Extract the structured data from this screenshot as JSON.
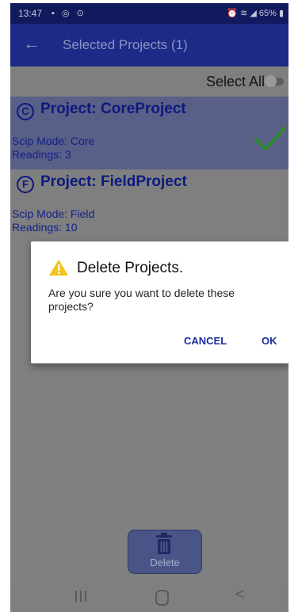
{
  "status_bar": {
    "time": "13:47",
    "left_icons": "▪ ◎ ⊙",
    "right_text": "⏰ ≋ ◢ 65% ▮"
  },
  "app_bar": {
    "back_icon": "←",
    "title": "Selected Projects (1)"
  },
  "select_all": {
    "label": "Select All",
    "checked": false
  },
  "projects": [
    {
      "icon_letter": "C",
      "name": "Project: CoreProject",
      "mode": "Scip Mode: Core",
      "readings": "Readings: 3",
      "selected": true
    },
    {
      "icon_letter": "F",
      "name": "Project: FieldProject",
      "mode": "Scip Mode: Field",
      "readings": "Readings: 10",
      "selected": false
    }
  ],
  "dialog": {
    "title": "Delete Projects.",
    "message": "Are you sure you want to delete these projects?",
    "cancel_label": "CANCEL",
    "ok_label": "OK"
  },
  "delete_button": {
    "label": "Delete"
  },
  "nav_bar": {
    "back_glyph": "<"
  },
  "colors": {
    "app_bar": "#1d2a86",
    "status_bar": "#121a5e",
    "selected_row": "#595f86",
    "accent_text": "#0c1a80",
    "check_green": "#2e8b2e",
    "warning_yellow": "#f2c318"
  }
}
